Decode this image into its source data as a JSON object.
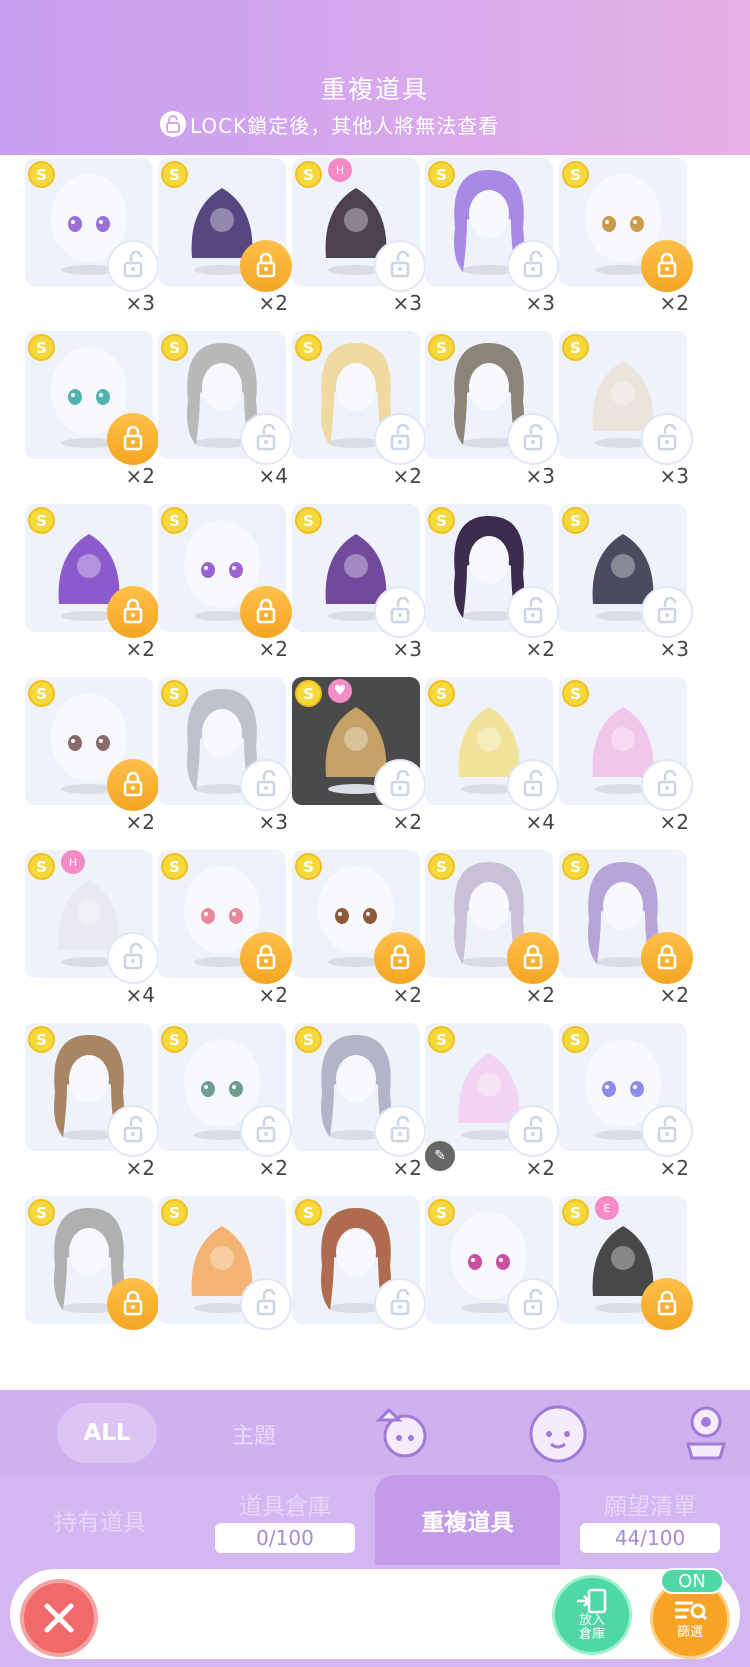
{
  "header": {
    "title": "重複道具",
    "subtitle": "LOCK鎖定後，其他人將無法查看"
  },
  "items": [
    {
      "count": "×3",
      "locked": false,
      "art": "eyes-purple",
      "tag": ""
    },
    {
      "count": "×2",
      "locked": true,
      "art": "dark-tails",
      "tag": ""
    },
    {
      "count": "×3",
      "locked": false,
      "art": "cat-ears",
      "tag": "H"
    },
    {
      "count": "×3",
      "locked": false,
      "art": "hair-long-purple",
      "tag": ""
    },
    {
      "count": "×2",
      "locked": true,
      "art": "eyes-amber",
      "tag": ""
    },
    {
      "count": "×2",
      "locked": true,
      "art": "eyes-teal",
      "tag": ""
    },
    {
      "count": "×4",
      "locked": false,
      "art": "hair-bob-grey",
      "tag": ""
    },
    {
      "count": "×2",
      "locked": false,
      "art": "hair-blonde",
      "tag": ""
    },
    {
      "count": "×3",
      "locked": false,
      "art": "hair-braids-ash",
      "tag": ""
    },
    {
      "count": "×3",
      "locked": false,
      "art": "hat-ribbons",
      "tag": ""
    },
    {
      "count": "×2",
      "locked": true,
      "art": "candy-purple",
      "tag": ""
    },
    {
      "count": "×2",
      "locked": true,
      "art": "eyes-violet",
      "tag": ""
    },
    {
      "count": "×3",
      "locked": false,
      "art": "bows-purple",
      "tag": ""
    },
    {
      "count": "×2",
      "locked": false,
      "art": "hair-twintails-dark",
      "tag": ""
    },
    {
      "count": "×3",
      "locked": false,
      "art": "perfume-bottle",
      "tag": ""
    },
    {
      "count": "×2",
      "locked": true,
      "art": "eyes-blush",
      "tag": ""
    },
    {
      "count": "×3",
      "locked": false,
      "art": "hair-wavy-silver",
      "tag": ""
    },
    {
      "count": "×2",
      "locked": false,
      "art": "golden-frame",
      "tag": "heart",
      "dark": true
    },
    {
      "count": "×4",
      "locked": false,
      "art": "halo-sparkle",
      "tag": ""
    },
    {
      "count": "×2",
      "locked": false,
      "art": "pink-sticker",
      "tag": ""
    },
    {
      "count": "×4",
      "locked": false,
      "art": "bunny-ears",
      "tag": "H"
    },
    {
      "count": "×2",
      "locked": true,
      "art": "eyes-pink",
      "tag": ""
    },
    {
      "count": "×2",
      "locked": true,
      "art": "eyes-brown",
      "tag": ""
    },
    {
      "count": "×2",
      "locked": true,
      "art": "hair-strand-ombre",
      "tag": ""
    },
    {
      "count": "×2",
      "locked": true,
      "art": "hair-strand-lilac",
      "tag": ""
    },
    {
      "count": "×2",
      "locked": false,
      "art": "hair-curly-brown",
      "tag": ""
    },
    {
      "count": "×2",
      "locked": false,
      "art": "eyes-green",
      "tag": ""
    },
    {
      "count": "×2",
      "locked": false,
      "art": "hair-side-silver",
      "tag": ""
    },
    {
      "count": "×2",
      "locked": false,
      "art": "photo-frame",
      "tag": "",
      "noedit": true
    },
    {
      "count": "×2",
      "locked": false,
      "art": "eyes-blue-pink",
      "tag": ""
    },
    {
      "count": "",
      "locked": true,
      "art": "hair-grey-long",
      "tag": ""
    },
    {
      "count": "",
      "locked": false,
      "art": "cat-plush",
      "tag": ""
    },
    {
      "count": "",
      "locked": false,
      "art": "hair-braid-auburn",
      "tag": ""
    },
    {
      "count": "",
      "locked": false,
      "art": "eyes-magenta",
      "tag": ""
    },
    {
      "count": "",
      "locked": true,
      "art": "wings-black",
      "tag": "E"
    }
  ],
  "coin_symbol": "S",
  "categories": {
    "all": "ALL",
    "theme": "主題",
    "icons": [
      "outfit-icon",
      "face-icon",
      "accessory-icon"
    ]
  },
  "tabs": [
    {
      "label": "持有道具",
      "count": ""
    },
    {
      "label": "道具倉庫",
      "count": "0/100"
    },
    {
      "label": "重複道具",
      "count": ""
    },
    {
      "label": "願望清單",
      "count": "44/100"
    }
  ],
  "bottom": {
    "store_label": "放入\n倉庫",
    "filter_label": "篩選",
    "on_label": "ON"
  },
  "colors": {
    "lock_closed": "#f4a623",
    "coin": "#f5d83c",
    "close": "#f06a6a",
    "store": "#4ed9a4"
  }
}
